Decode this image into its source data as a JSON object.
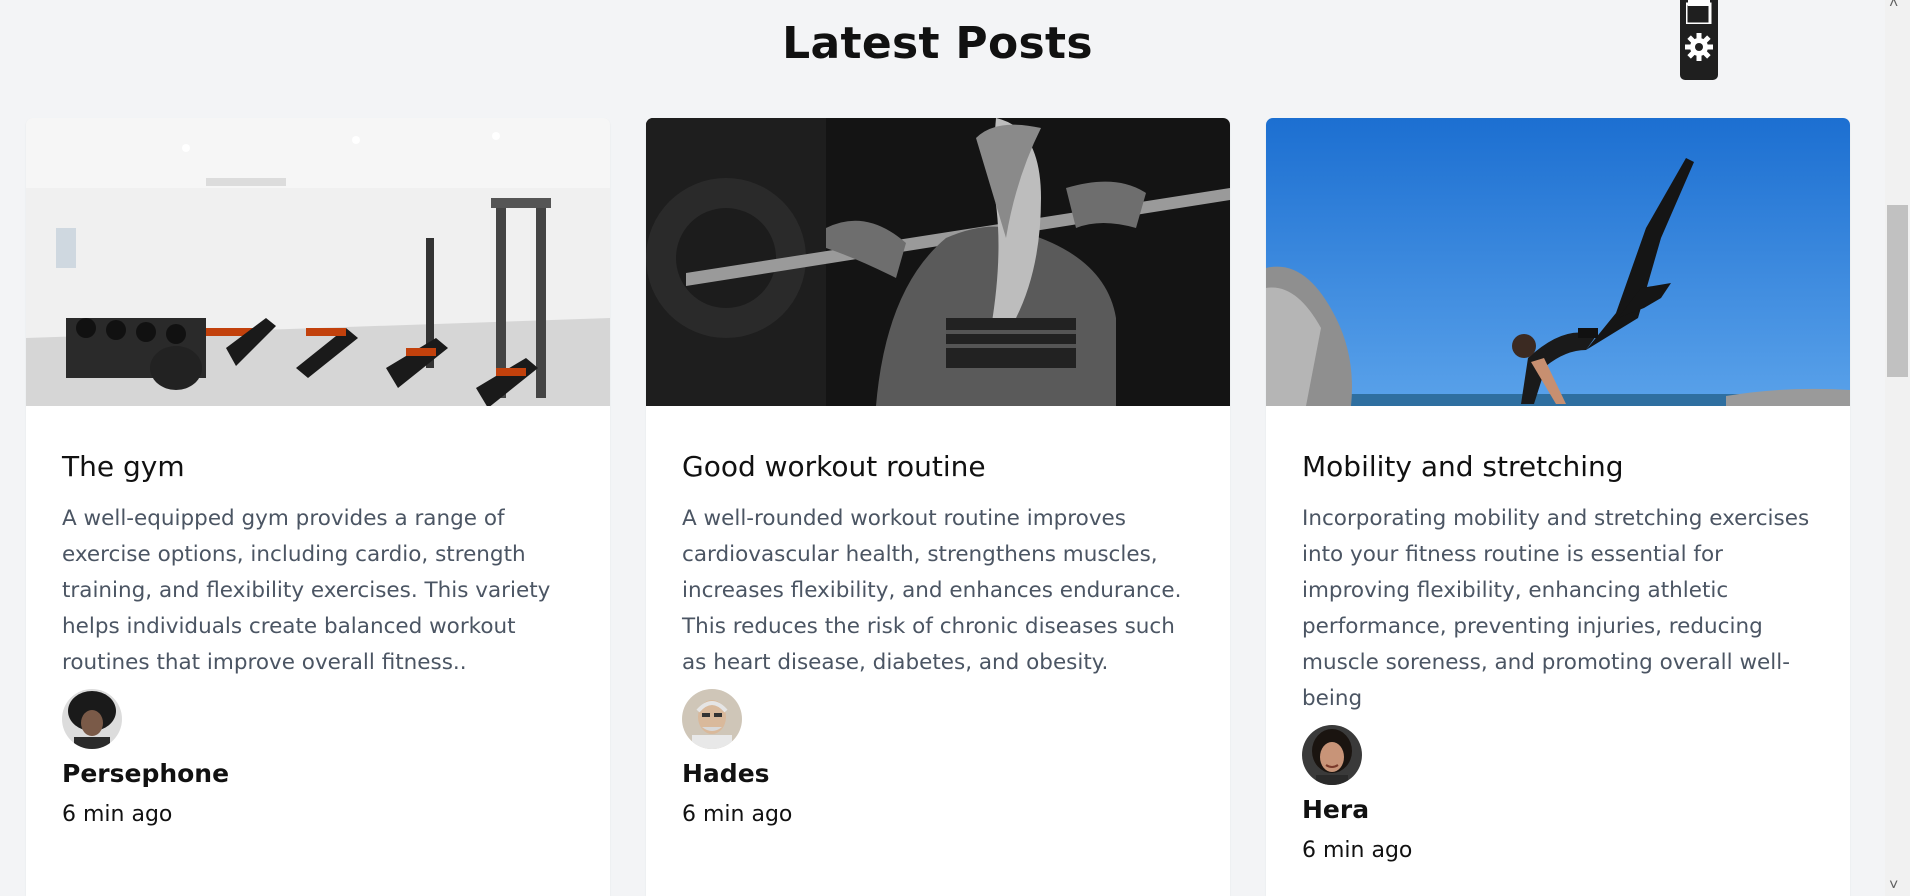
{
  "section": {
    "title": "Latest Posts"
  },
  "posts": [
    {
      "title": "The gym",
      "excerpt": "A well-equipped gym provides a range of exercise options, including cardio, strength training, and flexibility exercises. This variety helps individuals create balanced workout routines that improve overall fitness..",
      "author": "Persephone",
      "time": "6 min ago",
      "image_icon": "gym-photo",
      "avatar_icon": "avatar-persephone"
    },
    {
      "title": "Good workout routine",
      "excerpt": "A well-rounded workout routine improves cardiovascular health, strengthens muscles, increases flexibility, and enhances endurance. This reduces the risk of chronic diseases such as heart disease, diabetes, and obesity.",
      "author": "Hades",
      "time": "6 min ago",
      "image_icon": "barbell-squat-photo",
      "avatar_icon": "avatar-hades"
    },
    {
      "title": "Mobility and stretching",
      "excerpt": "Incorporating mobility and stretching exercises into your fitness routine is essential for improving flexibility, enhancing athletic performance, preventing injuries, reducing muscle soreness, and promoting overall well-being",
      "author": "Hera",
      "time": "6 min ago",
      "image_icon": "yoga-pose-photo",
      "avatar_icon": "avatar-hera"
    }
  ],
  "widget": {
    "icons": [
      "copy-icon",
      "gear-icon"
    ]
  },
  "colors": {
    "background": "#f3f4f6",
    "card": "#ffffff",
    "text": "#111111",
    "muted": "#4b5563"
  }
}
